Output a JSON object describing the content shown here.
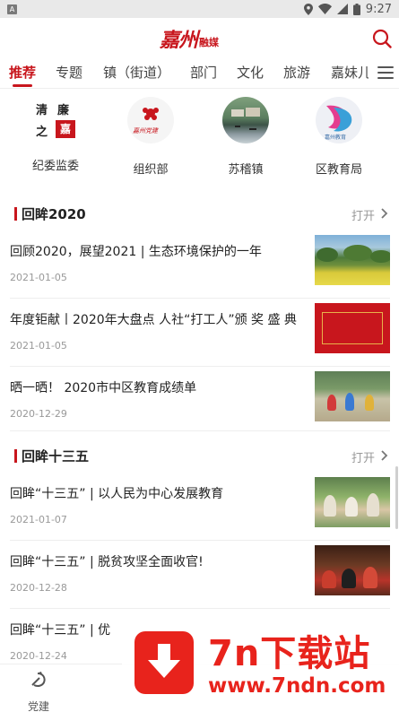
{
  "status_bar": {
    "notification_badge": "A",
    "time": "9:27"
  },
  "app": {
    "logo_text": "嘉州",
    "logo_sub": "融媒",
    "accent_color": "#c8161d"
  },
  "tabs": [
    "推荐",
    "专题",
    "镇（街道）",
    "部门",
    "文化",
    "旅游",
    "嘉妹儿"
  ],
  "categories": [
    {
      "label": "纪委监委",
      "icon": "qinglian-logo-icon",
      "icon_chars": [
        "清",
        "廉",
        "之",
        "嘉"
      ]
    },
    {
      "label": "组织部",
      "icon": "party-organization-logo-icon",
      "icon_text": "嘉州党建"
    },
    {
      "label": "苏稽镇",
      "icon": "town-photo-icon"
    },
    {
      "label": "区教育局",
      "icon": "education-bureau-logo-icon",
      "icon_text": "嘉州教育"
    }
  ],
  "sections": [
    {
      "title": "回眸2020",
      "more_label": "打开",
      "items": [
        {
          "title": "回顾2020，展望2021 | 生态环境保护的一年",
          "date": "2021-01-05",
          "thumb": "rapeseed-field-photo"
        },
        {
          "title": "年度钜献丨2020年大盘点 人社“打工人”颁 奖 盛 典",
          "date": "2021-01-05",
          "thumb": "red-award-banner"
        },
        {
          "title": "晒一晒！ 2020市中区教育成绩单",
          "date": "2020-12-29",
          "thumb": "kids-tricycle-photo"
        }
      ]
    },
    {
      "title": "回眸十三五",
      "more_label": "打开",
      "items": [
        {
          "title": "回眸“十三五” | 以人民为中心发展教育",
          "date": "2021-01-07",
          "thumb": "kindergarten-photo"
        },
        {
          "title": "回眸“十三五” | 脱贫攻坚全面收官!",
          "date": "2020-12-28",
          "thumb": "poverty-meeting-photo"
        },
        {
          "title": "回眸“十三五” | 优",
          "date": "2020-12-24",
          "thumb": ""
        }
      ]
    }
  ],
  "bottom_nav": [
    {
      "label": "党建",
      "icon": "party-emblem-icon"
    }
  ],
  "watermark": {
    "title": "7n下载站",
    "url": "www.7ndn.com"
  }
}
